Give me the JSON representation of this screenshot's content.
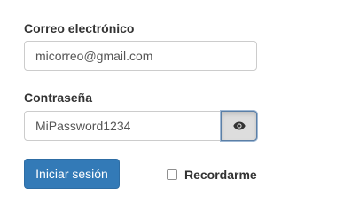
{
  "form": {
    "email_label": "Correo electrónico",
    "email_value": "micorreo@gmail.com",
    "password_label": "Contraseña",
    "password_value": "MiPassword1234",
    "toggle_icon": "eye-icon",
    "submit_label": "Iniciar sesión",
    "remember_label": "Recordarme",
    "remember_checked": false
  },
  "colors": {
    "primary": "#337ab7",
    "text": "#333333",
    "toggle_active_bg": "#dddddd"
  }
}
